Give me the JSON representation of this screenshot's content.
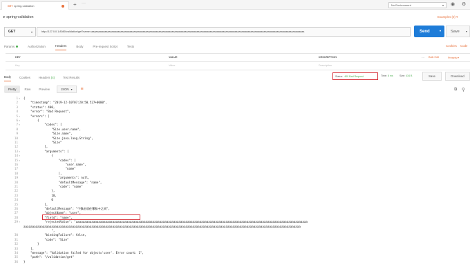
{
  "top_tab": {
    "method": "GET",
    "name": "spring-validation"
  },
  "top_tab_plus": "+",
  "top_tab_more": "···",
  "environment": "No Environment",
  "request_title": "▸ spring-validation",
  "examples_label": "Examples (0) ▾",
  "method": "GET",
  "url": "http://127.0.0.1:8080/validation/get?name=aaaaaaaaaaaaaaaaaaaaaaaaaaaaaaaaaaaaaaaaaaaaaaaaaaaaaaaaaaaaaaaaaaaaaaaaaaaaaaaaaaaaaaaaaaaaaaaaaaaaaaaaaaaaaaaaaaaaaaaaaaaaaaaaaaaaaaaaaaaaaaaaaa",
  "send_label": "Send",
  "save_label": "Save",
  "request_tabs": [
    {
      "label": "Params",
      "dot": true
    },
    {
      "label": "Authorization"
    },
    {
      "label": "Headers",
      "active": true
    },
    {
      "label": "Body"
    },
    {
      "label": "Pre-request Script"
    },
    {
      "label": "Tests"
    }
  ],
  "cookies_label": "Cookies",
  "code_label": "Code",
  "headers_table": {
    "columns": [
      "KEY",
      "VALUE",
      "DESCRIPTION"
    ],
    "placeholders": [
      "Key",
      "Value",
      "Description"
    ],
    "more": "···",
    "bulk_edit": "Bulk Edit",
    "presets": "Presets ▾"
  },
  "response_tabs": [
    {
      "label": "Body",
      "active": true
    },
    {
      "label": "Cookies"
    },
    {
      "label": "Headers",
      "count": "(4)"
    },
    {
      "label": "Test Results"
    }
  ],
  "status": {
    "label": "Status:",
    "value": "400 Bad Request"
  },
  "time": {
    "label": "Time:",
    "value": "8 ms"
  },
  "size": {
    "label": "Size:",
    "value": "434 B"
  },
  "resp_save": "Save",
  "resp_download": "Download",
  "view_modes": [
    "Pretty",
    "Raw",
    "Preview"
  ],
  "format": "JSON",
  "colors": {
    "accent": "#e8703a",
    "send": "#1e7cd8",
    "success": "#4caf50",
    "highlight": "#d9363e"
  },
  "code_lines": [
    {
      "n": "1",
      "f": "▾",
      "t": "{"
    },
    {
      "n": "2",
      "t": "    \"timestamp\": \"2019-12-10T07:20:50.527+0000\","
    },
    {
      "n": "3",
      "t": "    \"status\": 400,"
    },
    {
      "n": "4",
      "t": "    \"error\": \"Bad Request\","
    },
    {
      "n": "5",
      "f": "▾",
      "t": "    \"errors\": ["
    },
    {
      "n": "6",
      "f": "▾",
      "t": "        {"
    },
    {
      "n": "7",
      "f": "▾",
      "t": "            \"codes\": ["
    },
    {
      "n": "8",
      "t": "                \"Size.user.name\","
    },
    {
      "n": "9",
      "t": "                \"Size.name\","
    },
    {
      "n": "10",
      "t": "                \"Size.java.lang.String\","
    },
    {
      "n": "11",
      "t": "                \"Size\""
    },
    {
      "n": "12",
      "t": "            ],"
    },
    {
      "n": "13",
      "f": "▾",
      "t": "            \"arguments\": ["
    },
    {
      "n": "14",
      "f": "▾",
      "t": "                {"
    },
    {
      "n": "15",
      "f": "▾",
      "t": "                    \"codes\": ["
    },
    {
      "n": "16",
      "t": "                        \"user.name\","
    },
    {
      "n": "17",
      "t": "                        \"name\""
    },
    {
      "n": "18",
      "t": "                    ],"
    },
    {
      "n": "19",
      "t": "                    \"arguments\": null,"
    },
    {
      "n": "20",
      "t": "                    \"defaultMessage\": \"name\","
    },
    {
      "n": "21",
      "t": "                    \"code\": \"name\""
    },
    {
      "n": "22",
      "t": "                },"
    },
    {
      "n": "23",
      "t": "                10,"
    },
    {
      "n": "24",
      "t": "                0"
    },
    {
      "n": "25",
      "t": "            ],"
    },
    {
      "n": "26",
      "t": "            \"defaultMessage\": \"个数必须在零和十之间\","
    },
    {
      "n": "27",
      "t": "            \"objectName\": \"user\","
    },
    {
      "n": "28",
      "t": "            \"field\": \"name\","
    },
    {
      "n": "29",
      "f": "▾",
      "t": "            \"rejectedValue\": \"aaaaaaaaaaaaaaaaaaaaaaaaaaaaaaaaaaaaaaaaaaaaaaaaaaaaaaaaaaaaaaaaaaaaaaaaaaaaaaaaaaaaaaaaaaaaaaaaaaaaaaaaaaaaaaaaaaaaaaaaaaaaaaaaaaaaa"
    },
    {
      "n": "",
      "t": "aaaaaaaaaaaaaaaaaaaaaaaaaaaaaaaaaaaaaaaaaaaaaaaaaaaaaaaaaaaaaaaaaaaaaaaaaaaaaaaaaaaaaaaaaaaaaaaaaaaaaaaaaaaaaaaaaaaaaaaaaaaaaaaaaaaaaaaaaaaaaaaaaaaaaaaaaaaaaaa"
    },
    {
      "n": "",
      "t": "                \","
    },
    {
      "n": "30",
      "t": "            \"bindingFailure\": false,"
    },
    {
      "n": "31",
      "t": "            \"code\": \"Size\""
    },
    {
      "n": "32",
      "t": "        }"
    },
    {
      "n": "33",
      "t": "    ],"
    },
    {
      "n": "34",
      "t": "    \"message\": \"Validation failed for object='user'. Error count: 1\","
    },
    {
      "n": "35",
      "t": "    \"path\": \"/validation/get\""
    },
    {
      "n": "36",
      "t": "}"
    }
  ]
}
